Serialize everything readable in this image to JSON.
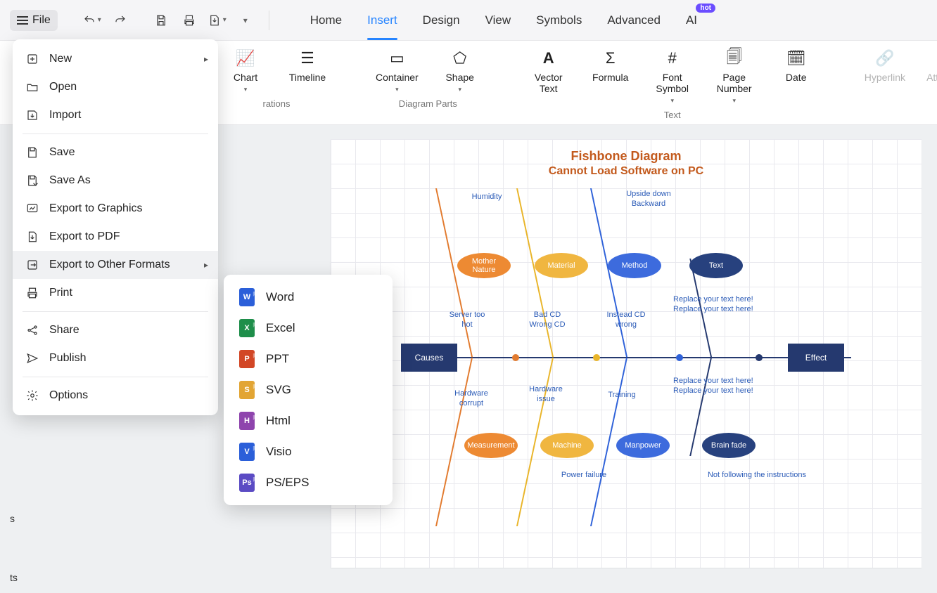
{
  "topbar": {
    "file_label": "File"
  },
  "tabs": {
    "home": "Home",
    "insert": "Insert",
    "design": "Design",
    "view": "View",
    "symbols": "Symbols",
    "advanced": "Advanced",
    "ai": "AI",
    "hot": "hot"
  },
  "ribbon": {
    "groups": {
      "illustrations": "rations",
      "parts": "Diagram Parts",
      "text": "Text"
    },
    "chart": "Chart",
    "timeline": "Timeline",
    "container": "Container",
    "shape": "Shape",
    "vectortext": "Vector\nText",
    "formula": "Formula",
    "fontsymbol": "Font\nSymbol",
    "pagenumber": "Page\nNumber",
    "date": "Date",
    "hyperlink": "Hyperlink",
    "attachment": "Attachmen"
  },
  "file_menu": {
    "new": "New",
    "open": "Open",
    "import": "Import",
    "save": "Save",
    "saveas": "Save As",
    "exportg": "Export to Graphics",
    "exportpdf": "Export to PDF",
    "exportother": "Export to Other Formats",
    "print": "Print",
    "share": "Share",
    "publish": "Publish",
    "options": "Options"
  },
  "submenu": {
    "word": "Word",
    "excel": "Excel",
    "ppt": "PPT",
    "svg": "SVG",
    "html": "Html",
    "visio": "Visio",
    "pseps": "PS/EPS"
  },
  "diagram": {
    "title": "Fishbone Diagram",
    "subtitle": "Cannot Load Software on PC",
    "causes": "Causes",
    "effect": "Effect",
    "humidity": "Humidity",
    "upside": "Upside down\nBackward",
    "mother": "Mother\nNature",
    "material": "Material",
    "method": "Method",
    "text": "Text",
    "serverhot": "Server too\nhot",
    "badcd": "Bad CD\nWrong CD",
    "insteadcd": "Instead CD\nwrong",
    "replace1": "Replace your text here!\nReplace your text here!",
    "hwcorrupt": "Hardware\ncorrupt",
    "hwissue": "Hardware\nissue",
    "training": "Training",
    "replace2": "Replace your text here!\nReplace your text here!",
    "measurement": "Measurement",
    "machine": "Machine",
    "manpower": "Manpower",
    "brainfade": "Brain fade",
    "powerfail": "Power failure",
    "notfollow": "Not following the instructions"
  },
  "ghost": {
    "s": "s",
    "ts": "ts"
  }
}
